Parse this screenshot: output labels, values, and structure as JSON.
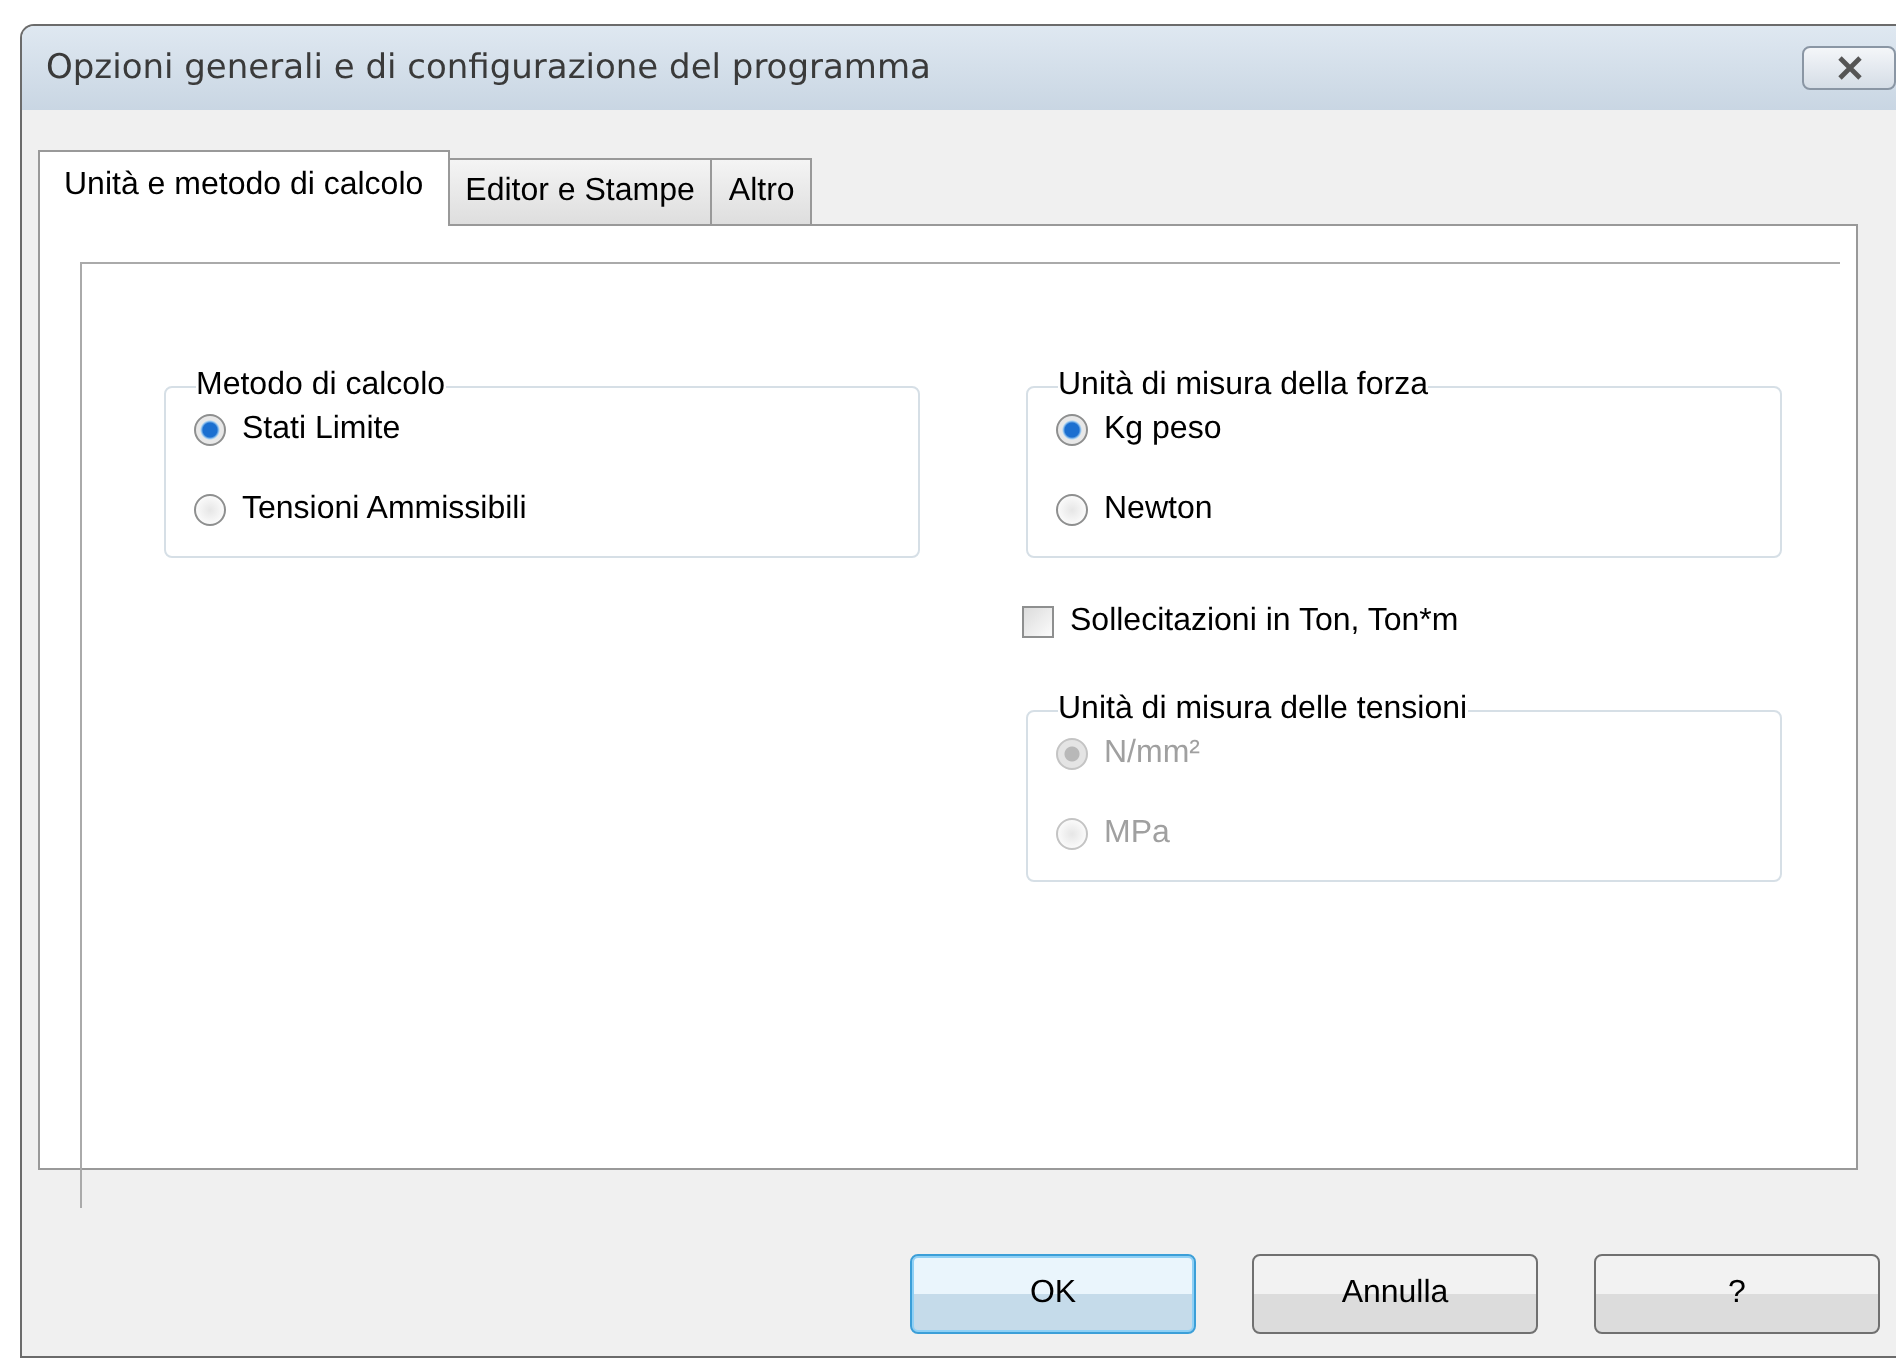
{
  "window": {
    "title": "Opzioni generali e di configurazione del programma"
  },
  "tabs": [
    {
      "label": "Unità e metodo di calcolo",
      "selected": true
    },
    {
      "label": "Editor e Stampe",
      "selected": false
    },
    {
      "label": "Altro",
      "selected": false
    }
  ],
  "left_column": [
    {
      "kind": "group",
      "legend": "Metodo di calcolo",
      "options": [
        {
          "label": "Stati Limite",
          "selected": true,
          "disabled": false
        },
        {
          "label": "Tensioni Ammissibili",
          "selected": false,
          "disabled": false
        }
      ]
    }
  ],
  "right_column": [
    {
      "kind": "group",
      "legend": "Unità di misura della forza",
      "options": [
        {
          "label": "Kg peso",
          "selected": true,
          "disabled": false
        },
        {
          "label": "Newton",
          "selected": false,
          "disabled": false
        }
      ]
    },
    {
      "kind": "checkbox",
      "label": "Sollecitazioni in Ton, Ton*m",
      "checked": false
    },
    {
      "kind": "group",
      "legend": "Unità di misura delle tensioni",
      "options": [
        {
          "label": "N/mm²",
          "selected": true,
          "disabled": true
        },
        {
          "label": "MPa",
          "selected": false,
          "disabled": true
        }
      ]
    }
  ],
  "buttons": [
    {
      "label": "OK",
      "focused": true
    },
    {
      "label": "Annulla",
      "focused": false
    },
    {
      "label": "?",
      "focused": false
    }
  ]
}
